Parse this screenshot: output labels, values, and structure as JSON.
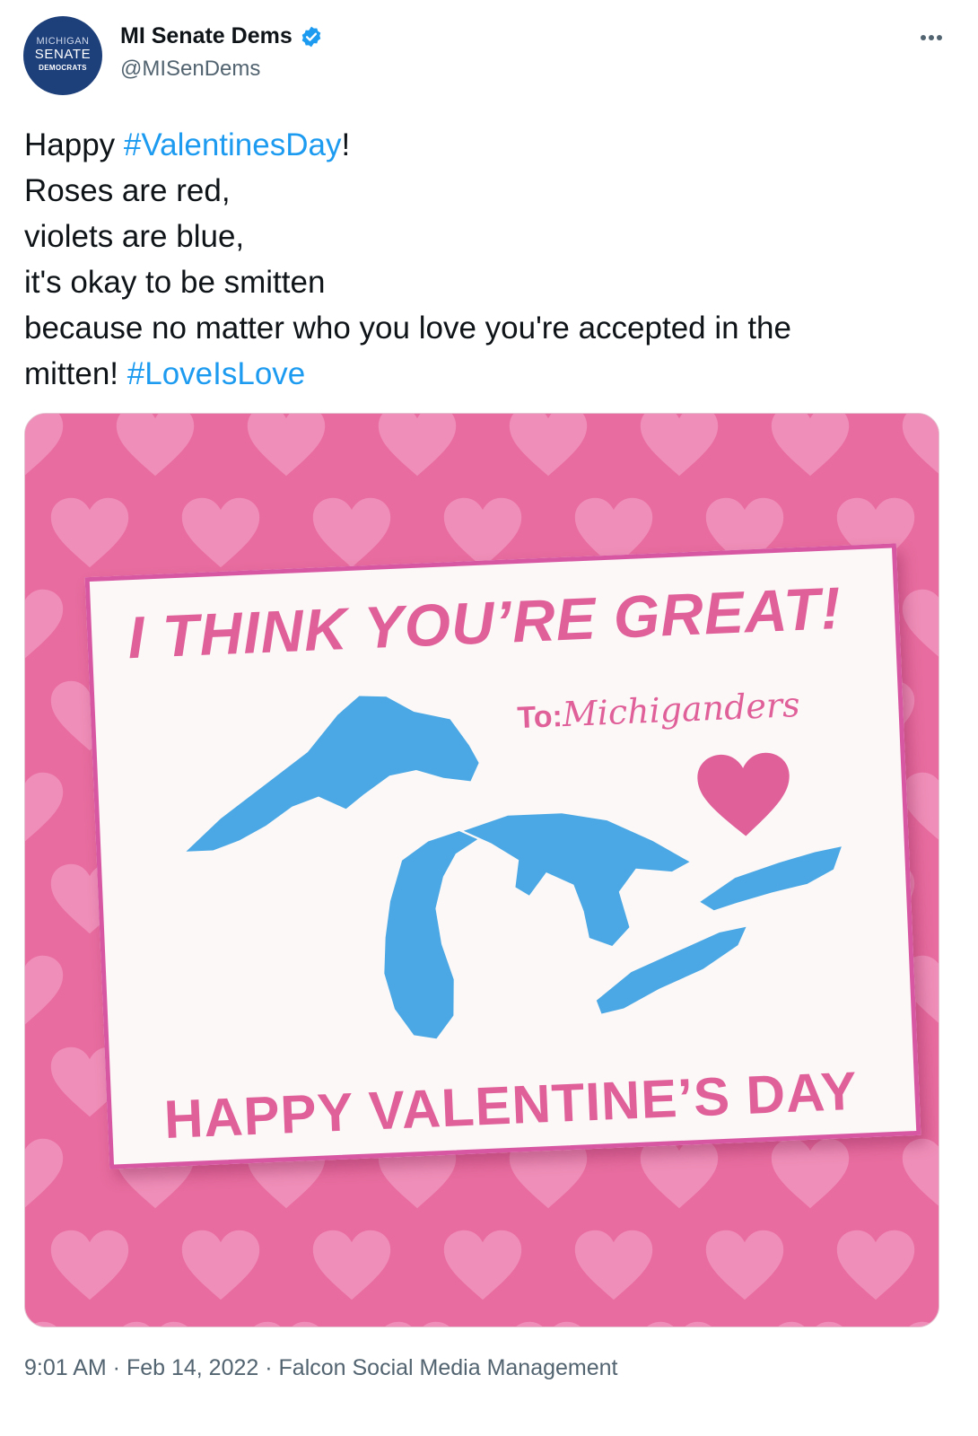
{
  "account": {
    "display_name": "MI Senate Dems",
    "handle": "@MISenDems",
    "avatar_lines": [
      "MICHIGAN",
      "SENATE",
      "DEMOCRATS"
    ]
  },
  "tweet": {
    "line1_prefix": "Happy ",
    "line1_hashtag": "#ValentinesDay",
    "line1_suffix": "!",
    "line2": "Roses are red,",
    "line3": "violets are blue,",
    "line4": "it's okay to be smitten",
    "line5": "because no matter who you love you're accepted in the",
    "line6_prefix": "mitten! ",
    "line6_hashtag": "#LoveIsLove"
  },
  "card": {
    "title": "I THINK YOU’RE GREAT!",
    "to_label": "To:",
    "to_name": "Michiganders",
    "footer": "HAPPY VALENTINE’S DAY"
  },
  "meta": {
    "time": "9:01 AM",
    "date": "Feb 14, 2022",
    "source": "Falcon Social Media Management",
    "separator": " · "
  },
  "colors": {
    "hashtag": "#1d9bf0",
    "card_pink": "#e0609a",
    "background_pink": "#e86c9f",
    "lake_blue": "#4ba8e4",
    "avatar_navy": "#1d3f7a"
  },
  "icons": [
    "verified-badge-icon",
    "more-options-icon",
    "heart-icon"
  ]
}
